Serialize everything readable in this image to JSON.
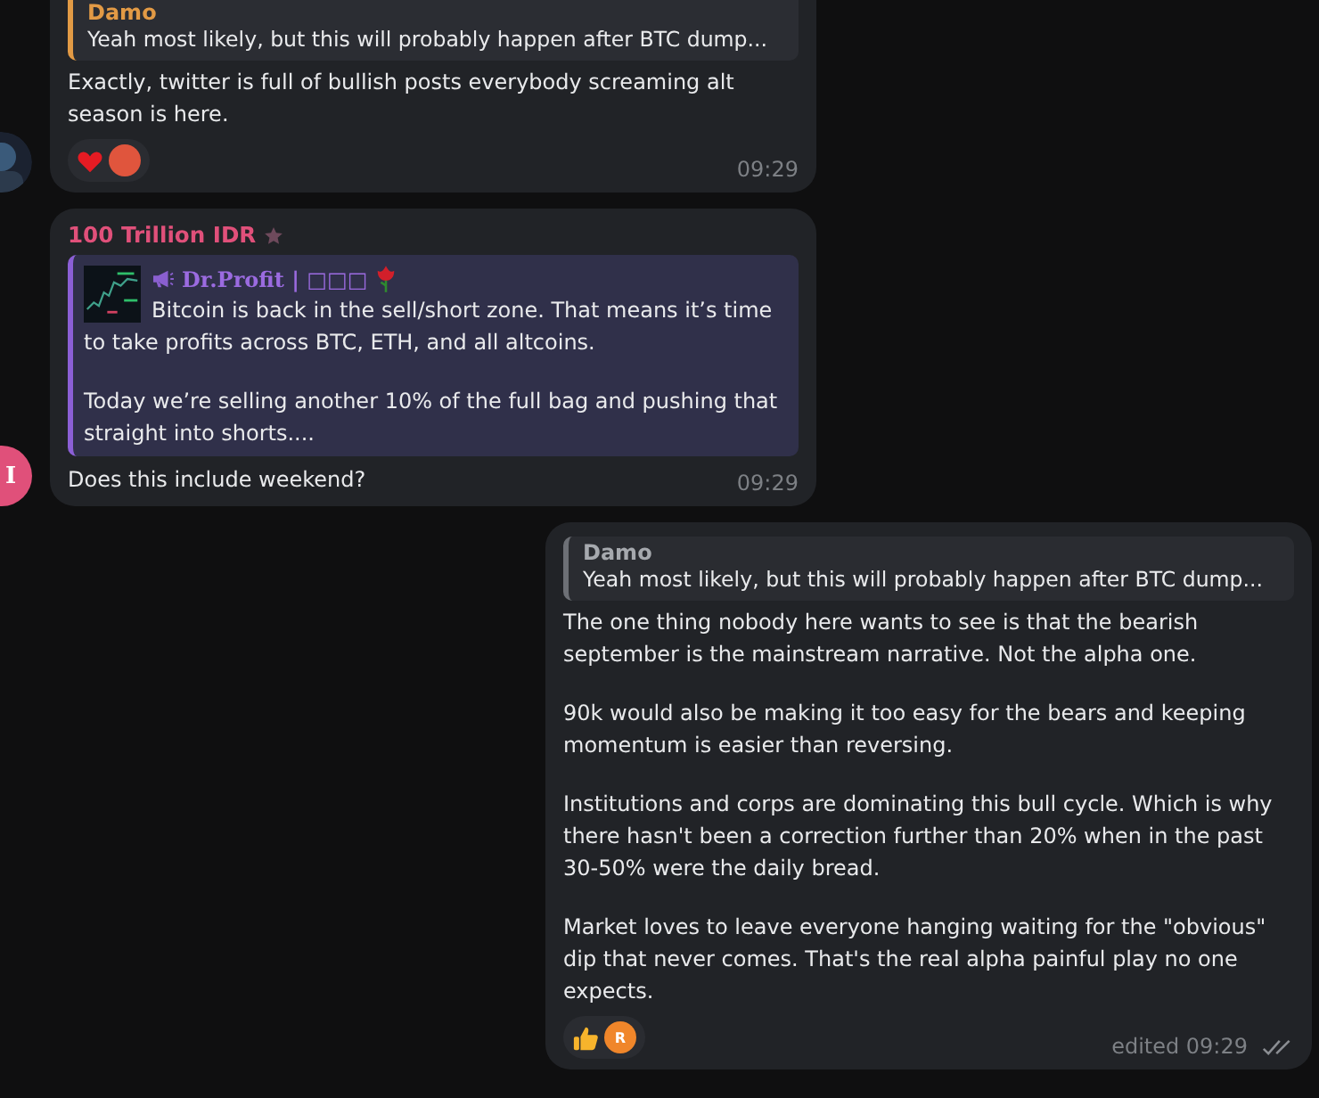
{
  "messages": [
    {
      "kind": "incoming",
      "avatar": {
        "kind": "picture"
      },
      "reply": {
        "author": "Damo",
        "color": "#e29a45",
        "text": "Yeah most likely, but this will probably happen after BTC dump..."
      },
      "paragraphs": [
        "Exactly, twitter is full of bullish posts everybody screaming alt season is here."
      ],
      "reactions": [
        {
          "kind": "heart"
        },
        {
          "kind": "avatar",
          "color": "#e0553d"
        }
      ],
      "time": "09:29"
    },
    {
      "kind": "incoming",
      "avatar": {
        "kind": "letter",
        "letter": "I",
        "color": "#e0507a"
      },
      "sender": {
        "name": "100 Trillion IDR",
        "color": "#e0507a"
      },
      "forward": {
        "channel": "Dr.Profit | □□□",
        "paragraphs": [
          "Bitcoin is back in the sell/short zone. That means it’s time to take profits across BTC, ETH, and all altcoins.",
          "Today we’re selling another 10% of the full bag and pushing that straight into shorts...."
        ]
      },
      "paragraphs": [
        "Does this include weekend?"
      ],
      "time": "09:29"
    },
    {
      "kind": "outgoing",
      "reply": {
        "author": "Damo",
        "color": "#6d7076",
        "text": "Yeah most likely, but this will probably happen after BTC dump..."
      },
      "paragraphs": [
        "The one thing nobody here wants to see is that the bearish september is the mainstream narrative. Not the alpha one.",
        "90k would also be making it too easy for the bears and keeping momentum is easier than reversing.",
        "Institutions and corps are dominating this bull cycle. Which is why there hasn't been a correction further than 20% when in the past 30-50% were the daily bread.",
        "Market loves to leave everyone hanging waiting for the \"obvious\" dip that never comes. That's the real alpha painful play no one expects."
      ],
      "reactions": [
        {
          "kind": "thumbs-up"
        },
        {
          "kind": "avatar",
          "letter": "R",
          "color": "#f0862a"
        }
      ],
      "edited": "edited",
      "time": "09:29",
      "read": true
    }
  ]
}
